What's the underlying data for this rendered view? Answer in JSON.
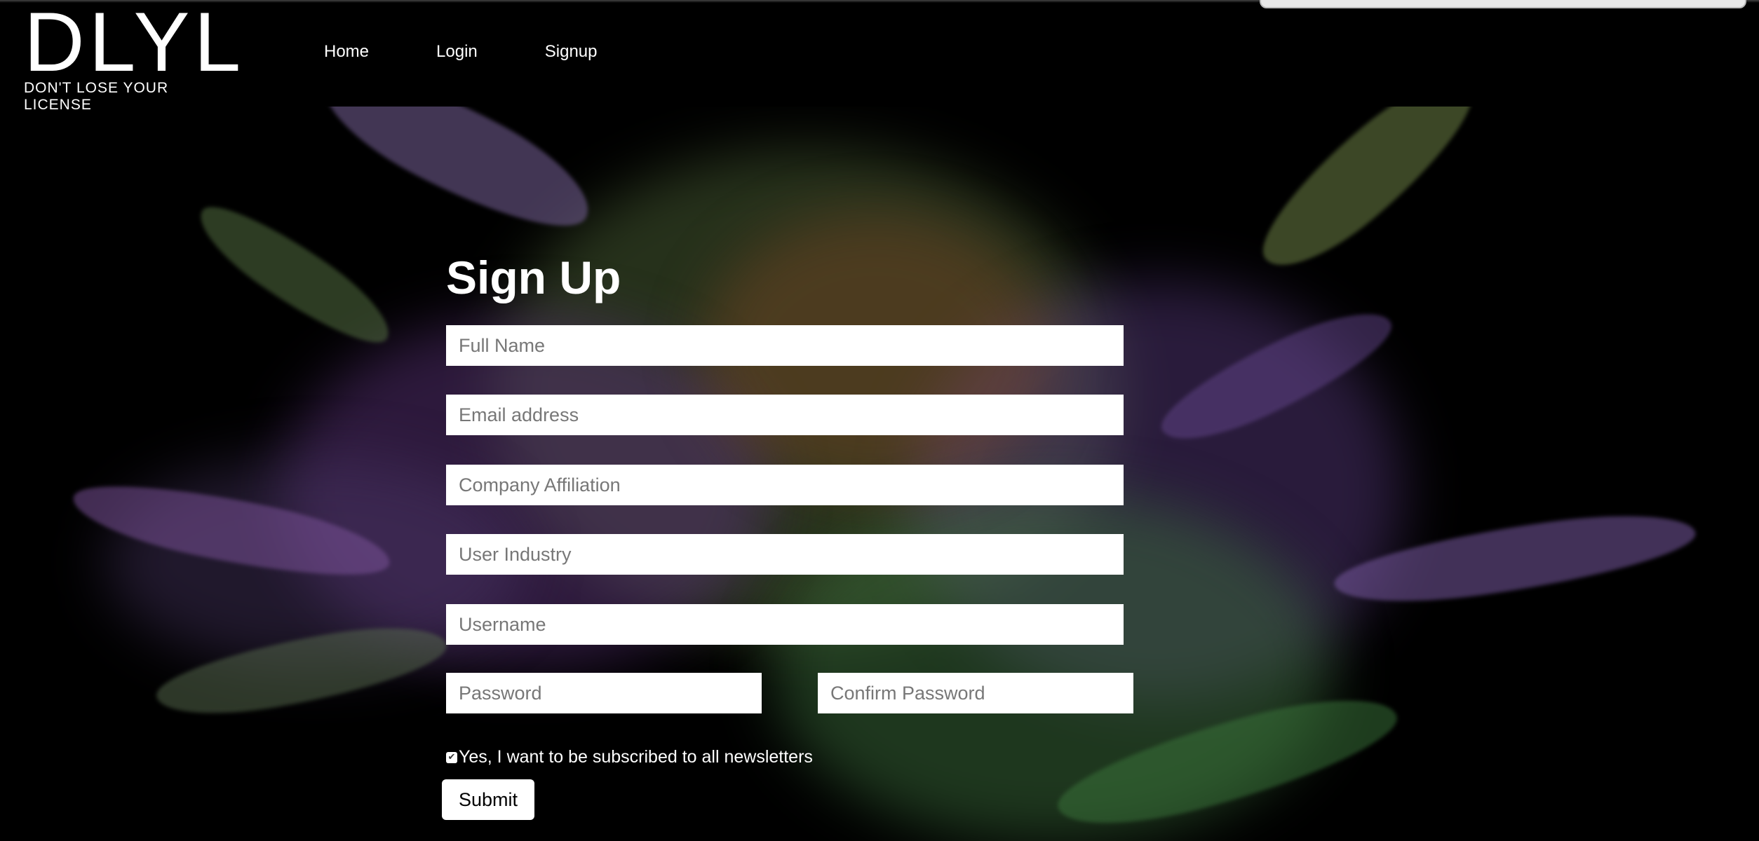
{
  "logo": {
    "mark": "DLYL",
    "tagline": "DON'T LOSE YOUR LICENSE"
  },
  "nav": {
    "items": [
      {
        "label": "Home"
      },
      {
        "label": "Login"
      },
      {
        "label": "Signup"
      }
    ]
  },
  "signup_form": {
    "title": "Sign Up",
    "full_name_placeholder": "Full Name",
    "email_placeholder": "Email address",
    "company_placeholder": "Company Affiliation",
    "industry_placeholder": "User Industry",
    "username_placeholder": "Username",
    "password_placeholder": "Password",
    "confirm_password_placeholder": "Confirm Password",
    "newsletter_checked": true,
    "newsletter_label": "Yes, I want to be subscribed to all newsletters",
    "submit_label": "Submit"
  },
  "colors": {
    "background": "#000000",
    "text": "#ffffff",
    "field_background": "#ffffff",
    "placeholder": "#777777"
  }
}
